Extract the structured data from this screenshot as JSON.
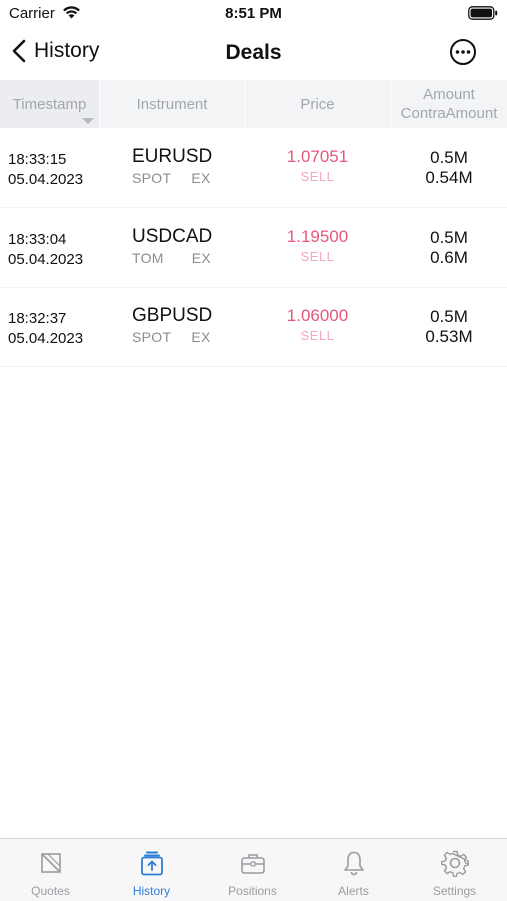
{
  "status_bar": {
    "carrier": "Carrier",
    "time": "8:51 PM"
  },
  "nav": {
    "back_label": "History",
    "title": "Deals"
  },
  "table": {
    "headers": {
      "timestamp": "Timestamp",
      "instrument": "Instrument",
      "price": "Price",
      "amount": "Amount",
      "contra_amount": "ContraAmount"
    },
    "rows": [
      {
        "time": "18:33:15",
        "date": "05.04.2023",
        "symbol": "EURUSD",
        "tenor": "SPOT",
        "venue": "EX",
        "price": "1.07051",
        "side": "SELL",
        "amount": "0.5M",
        "contra_amount": "0.54M"
      },
      {
        "time": "18:33:04",
        "date": "05.04.2023",
        "symbol": "USDCAD",
        "tenor": "TOM",
        "venue": "EX",
        "price": "1.19500",
        "side": "SELL",
        "amount": "0.5M",
        "contra_amount": "0.6M"
      },
      {
        "time": "18:32:37",
        "date": "05.04.2023",
        "symbol": "GBPUSD",
        "tenor": "SPOT",
        "venue": "EX",
        "price": "1.06000",
        "side": "SELL",
        "amount": "0.5M",
        "contra_amount": "0.53M"
      }
    ]
  },
  "tab_bar": {
    "active": "history",
    "tabs": [
      {
        "id": "quotes",
        "label": "Quotes",
        "icon": "quotes-icon"
      },
      {
        "id": "history",
        "label": "History",
        "icon": "history-icon"
      },
      {
        "id": "positions",
        "label": "Positions",
        "icon": "briefcase-icon"
      },
      {
        "id": "alerts",
        "label": "Alerts",
        "icon": "bell-icon"
      },
      {
        "id": "settings",
        "label": "Settings",
        "icon": "gear-icon"
      }
    ]
  },
  "colors": {
    "sell_price": "#e8577a",
    "sell_label": "#f4a8ba",
    "accent": "#2f7fd6"
  }
}
